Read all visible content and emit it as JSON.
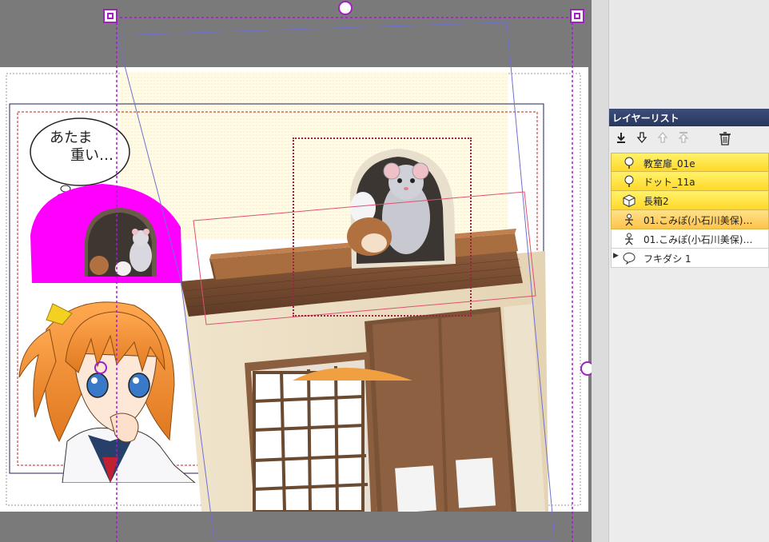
{
  "canvas": {
    "speech_bubble_text": [
      "あたま",
      "重い…"
    ]
  },
  "layer_panel": {
    "title": "レイヤーリスト",
    "toolbar": [
      {
        "icon": "download-arrow-icon",
        "enabled": true
      },
      {
        "icon": "move-down-icon",
        "enabled": true
      },
      {
        "icon": "move-up-icon",
        "enabled": false
      },
      {
        "icon": "move-top-icon",
        "enabled": false
      },
      {
        "icon": "trash-icon",
        "enabled": true
      }
    ],
    "layers": [
      {
        "label": "教室扉_01e",
        "icon": "tree-icon",
        "state": "selected"
      },
      {
        "label": "ドット_11a",
        "icon": "tree-icon",
        "state": "selected"
      },
      {
        "label": "長箱2",
        "icon": "box-icon",
        "state": "selected"
      },
      {
        "label": "01.こみぽ(小石川美保)…",
        "icon": "person-icon",
        "state": "active"
      },
      {
        "label": "01.こみぽ(小石川美保)…",
        "icon": "person-icon",
        "state": "normal"
      },
      {
        "label": "フキダシ 1",
        "icon": "speech-bubble-icon",
        "state": "normal",
        "expandable": true
      }
    ]
  },
  "colors": {
    "selection_magenta": "#a020c0",
    "dot_panel": "#fffbe6",
    "magenta_object": "#ff00ff",
    "panel_header": "#2e3c66",
    "layer_selected": "#ffe040"
  }
}
